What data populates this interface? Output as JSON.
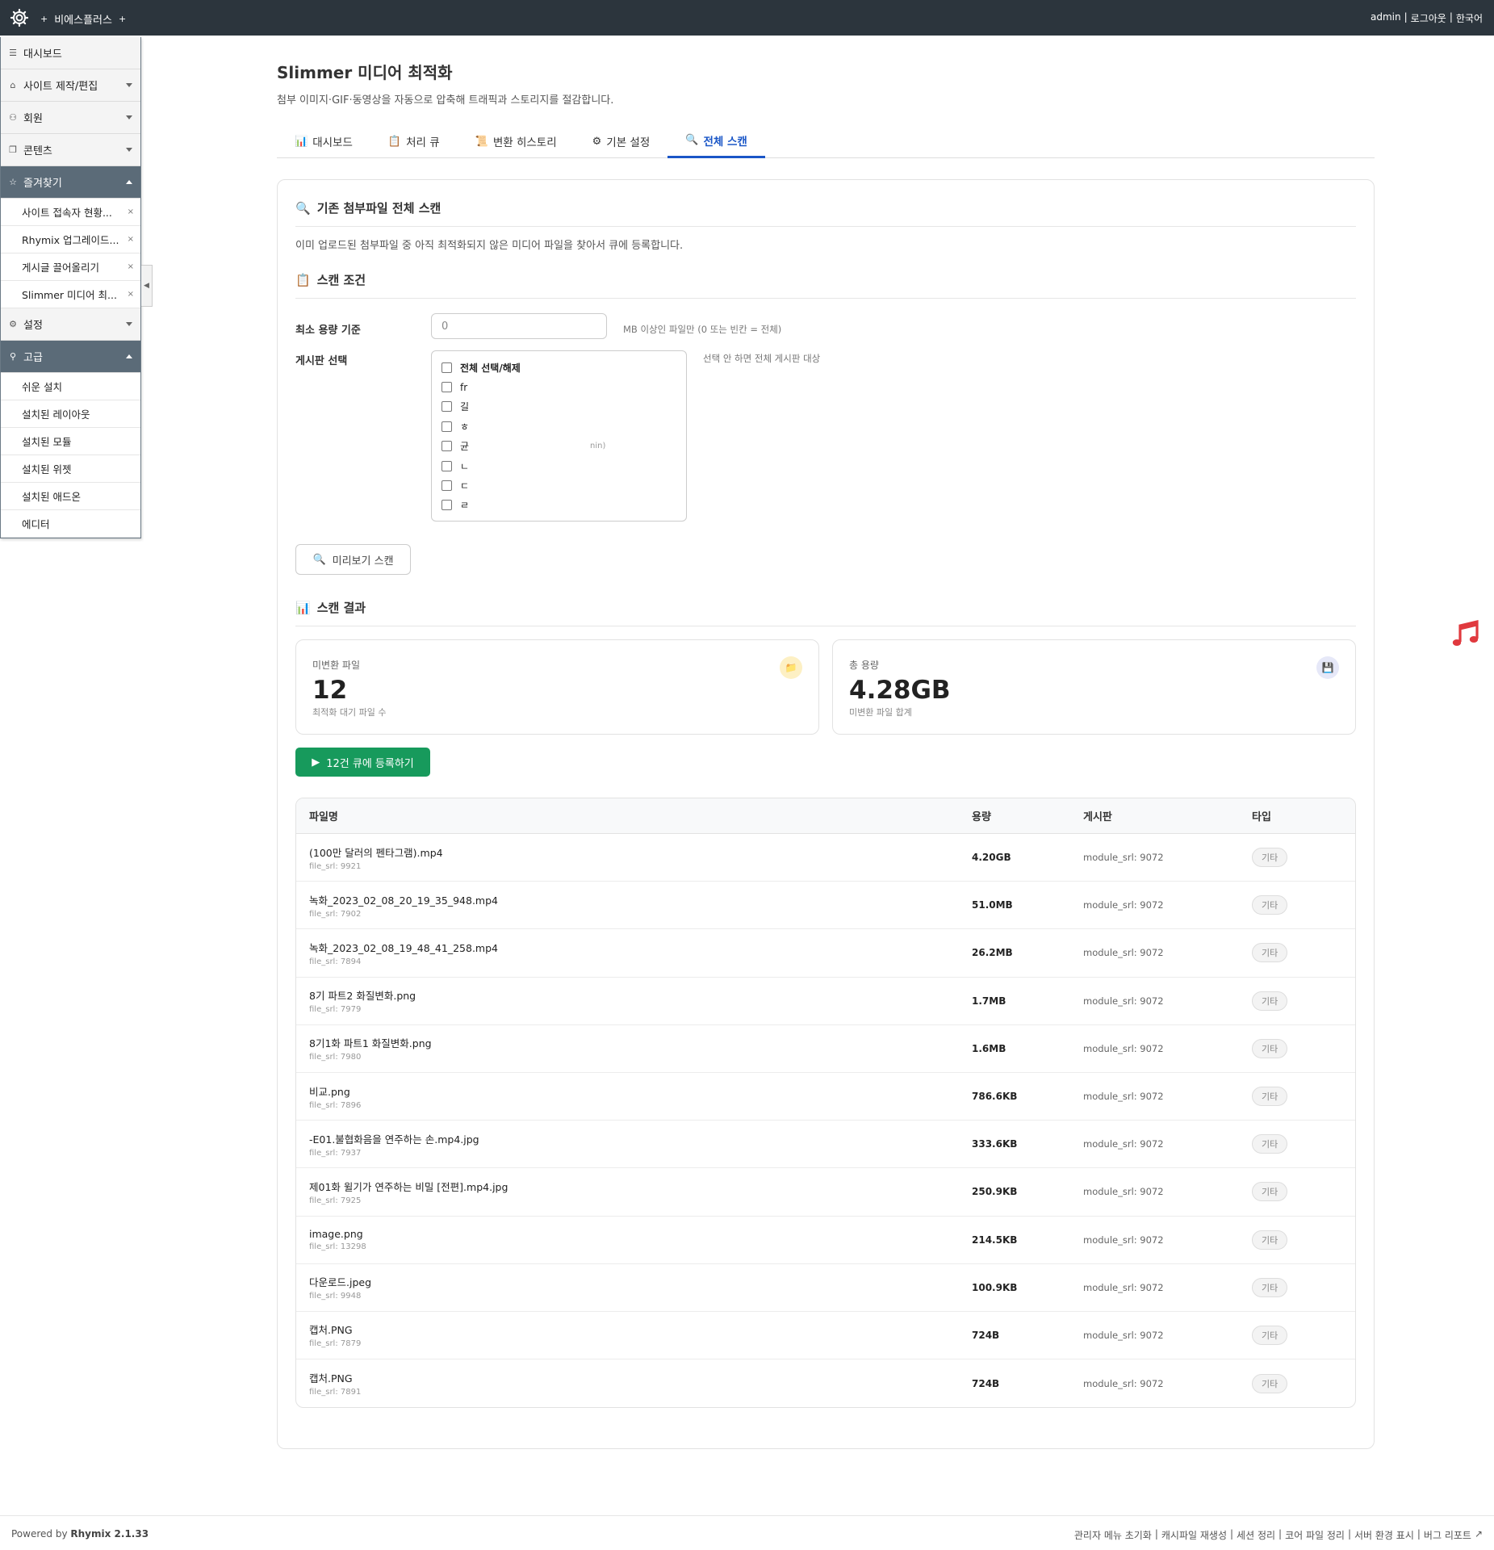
{
  "topbar": {
    "site_name": "비에스플러스",
    "plus": "+",
    "right_links": [
      "admin",
      "로그아웃",
      "한국어"
    ],
    "sep": "|"
  },
  "sidebar": {
    "items": [
      {
        "label": "대시보드",
        "icon": "list-icon",
        "caret": false,
        "active": false
      },
      {
        "label": "사이트 제작/편집",
        "icon": "home-icon",
        "caret": true,
        "active": false
      },
      {
        "label": "회원",
        "icon": "users-icon",
        "caret": true,
        "active": false
      },
      {
        "label": "콘텐츠",
        "icon": "copy-icon",
        "caret": true,
        "active": false
      },
      {
        "label": "즐겨찾기",
        "icon": "star-icon",
        "caret": true,
        "active": true
      }
    ],
    "favorites": [
      "사이트 접속자 현황...",
      "Rhymix 업그레이드...",
      "게시글 끌어올리기",
      "Slimmer 미디어 최..."
    ],
    "settings": {
      "label": "설정",
      "icon": "cog-icon"
    },
    "advanced": {
      "label": "고급",
      "icon": "pin-icon"
    },
    "advanced_items": [
      "쉬운 설치",
      "설치된 레이아웃",
      "설치된 모듈",
      "설치된 위젯",
      "설치된 애드온",
      "에디터"
    ],
    "close_glyph": "×"
  },
  "page": {
    "title": "Slimmer 미디어 최적화",
    "desc": "첨부 이미지·GIF·동영상을 자동으로 압축해 트래픽과 스토리지를 절감합니다."
  },
  "tabs": [
    {
      "label": "대시보드",
      "icon": "📊",
      "active": false
    },
    {
      "label": "처리 큐",
      "icon": "📋",
      "active": false
    },
    {
      "label": "변환 히스토리",
      "icon": "📜",
      "active": false
    },
    {
      "label": "기본 설정",
      "icon": "⚙",
      "active": false
    },
    {
      "label": "전체 스캔",
      "icon": "🔍",
      "active": true
    }
  ],
  "scan": {
    "title": "기존 첨부파일 전체 스캔",
    "title_icon": "🔍",
    "desc": "이미 업로드된 첨부파일 중 아직 최적화되지 않은 미디어 파일을 찾아서 큐에 등록합니다.",
    "cond_title": "스캔 조건",
    "cond_icon": "📋",
    "min_size_label": "최소 용량 기준",
    "min_size_value": "0",
    "min_size_hint": "MB 이상인 파일만 (0 또는 빈칸 = 전체)",
    "board_label": "게시판 선택",
    "board_hint": "선택 안 하면 전체 게시판 대상",
    "board_select_all": "전체 선택/해제",
    "board_options": [
      "fr",
      "길",
      "ㅎ",
      "균",
      "ㄴ",
      "ㄷ",
      "ㄹ"
    ],
    "board_option_suffix": "nin)",
    "preview_button": "미리보기 스캔",
    "preview_icon": "🔍",
    "result_title": "스캔 결과",
    "result_icon": "📊"
  },
  "stats": [
    {
      "label": "미변환 파일",
      "value": "12",
      "sub": "최적화 대기 파일 수",
      "icon": "folder-icon",
      "glyph": "📁",
      "color": "#fdf0c4"
    },
    {
      "label": "총 용량",
      "value": "4.28GB",
      "sub": "미변환 파일 합계",
      "icon": "floppy-icon",
      "glyph": "💾",
      "color": "#e6e8f8"
    }
  ],
  "queue_button": "12건 큐에 등록하기",
  "table": {
    "headers": [
      "파일명",
      "용량",
      "게시판",
      "타입"
    ],
    "rows": [
      {
        "name": "(100만 달러의 펜타그램).mp4",
        "srl": "file_srl: 9921",
        "size": "4.20GB",
        "board": "module_srl: 9072",
        "type": "기타"
      },
      {
        "name": "녹화_2023_02_08_20_19_35_948.mp4",
        "srl": "file_srl: 7902",
        "size": "51.0MB",
        "board": "module_srl: 9072",
        "type": "기타"
      },
      {
        "name": "녹화_2023_02_08_19_48_41_258.mp4",
        "srl": "file_srl: 7894",
        "size": "26.2MB",
        "board": "module_srl: 9072",
        "type": "기타"
      },
      {
        "name": "8기 파트2 화질변화.png",
        "srl": "file_srl: 7979",
        "size": "1.7MB",
        "board": "module_srl: 9072",
        "type": "기타"
      },
      {
        "name": "8기1화 파트1 화질변화.png",
        "srl": "file_srl: 7980",
        "size": "1.6MB",
        "board": "module_srl: 9072",
        "type": "기타"
      },
      {
        "name": "비교.png",
        "srl": "file_srl: 7896",
        "size": "786.6KB",
        "board": "module_srl: 9072",
        "type": "기타"
      },
      {
        "name": "-E01.불협화음을 연주하는 손.mp4.jpg",
        "srl": "file_srl: 7937",
        "size": "333.6KB",
        "board": "module_srl: 9072",
        "type": "기타"
      },
      {
        "name": "제01화 윌기가 연주하는 비밀 [전편].mp4.jpg",
        "srl": "file_srl: 7925",
        "size": "250.9KB",
        "board": "module_srl: 9072",
        "type": "기타"
      },
      {
        "name": "image.png",
        "srl": "file_srl: 13298",
        "size": "214.5KB",
        "board": "module_srl: 9072",
        "type": "기타"
      },
      {
        "name": "다운로드.jpeg",
        "srl": "file_srl: 9948",
        "size": "100.9KB",
        "board": "module_srl: 9072",
        "type": "기타"
      },
      {
        "name": "캡처.PNG",
        "srl": "file_srl: 7879",
        "size": "724B",
        "board": "module_srl: 9072",
        "type": "기타"
      },
      {
        "name": "캡처.PNG",
        "srl": "file_srl: 7891",
        "size": "724B",
        "board": "module_srl: 9072",
        "type": "기타"
      }
    ]
  },
  "footer": {
    "powered_prefix": "Powered by",
    "powered_name": "Rhymix 2.1.33",
    "links": [
      "관리자 메뉴 초기화",
      "캐시파일 재생성",
      "세션 정리",
      "코어 파일 정리",
      "서버 환경 표시",
      "버그 리포트"
    ]
  },
  "colors": {
    "topbar": "#2c353d",
    "accent": "#1a56c7",
    "queue_button": "#179a5c",
    "sidebar_active": "#5b6b78",
    "music_note": "#e0393e"
  }
}
